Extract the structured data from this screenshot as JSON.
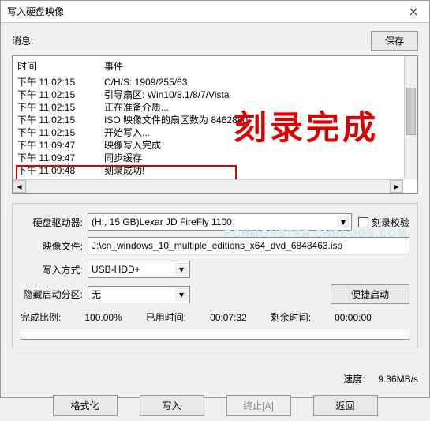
{
  "window": {
    "title": "写入硬盘映像"
  },
  "msg_label": "消息:",
  "save_btn": "保存",
  "log": {
    "col_time": "时间",
    "col_event": "事件",
    "rows": [
      {
        "t": "下午 11:02:15",
        "e": "C/H/S: 1909/255/63"
      },
      {
        "t": "下午 11:02:15",
        "e": "引导扇区: Win10/8.1/8/7/Vista"
      },
      {
        "t": "下午 11:02:15",
        "e": "正在准备介质..."
      },
      {
        "t": "下午 11:02:15",
        "e": "ISO 映像文件的扇区数为 8462880"
      },
      {
        "t": "下午 11:02:15",
        "e": "开始写入..."
      },
      {
        "t": "下午 11:09:47",
        "e": "映像写入完成"
      },
      {
        "t": "下午 11:09:47",
        "e": "同步缓存"
      },
      {
        "t": "下午 11:09:48",
        "e": "刻录成功!"
      }
    ]
  },
  "overlay_text": "刻录完成",
  "watermark": "PCHMONSTER.CNBLOGS.COM",
  "form": {
    "drive_lbl": "硬盘驱动器:",
    "drive_val": "(H:, 15 GB)Lexar   JD FireFly    1100",
    "verify_lbl": "刻录校验",
    "image_lbl": "映像文件:",
    "image_val": "J:\\cn_windows_10_multiple_editions_x64_dvd_6848463.iso",
    "method_lbl": "写入方式:",
    "method_val": "USB-HDD+",
    "hidden_lbl": "隐藏启动分区:",
    "hidden_val": "无",
    "boot_btn": "便捷启动",
    "progress_lbl": "完成比例:",
    "progress_val": "100.00%",
    "elapsed_lbl": "已用时间:",
    "elapsed_val": "00:07:32",
    "remain_lbl": "剩余时间:",
    "remain_val": "00:00:00"
  },
  "speed_lbl": "速度:",
  "speed_val": "9.36MB/s",
  "buttons": {
    "format": "格式化",
    "write": "写入",
    "abort": "终止[A]",
    "back": "返回"
  }
}
